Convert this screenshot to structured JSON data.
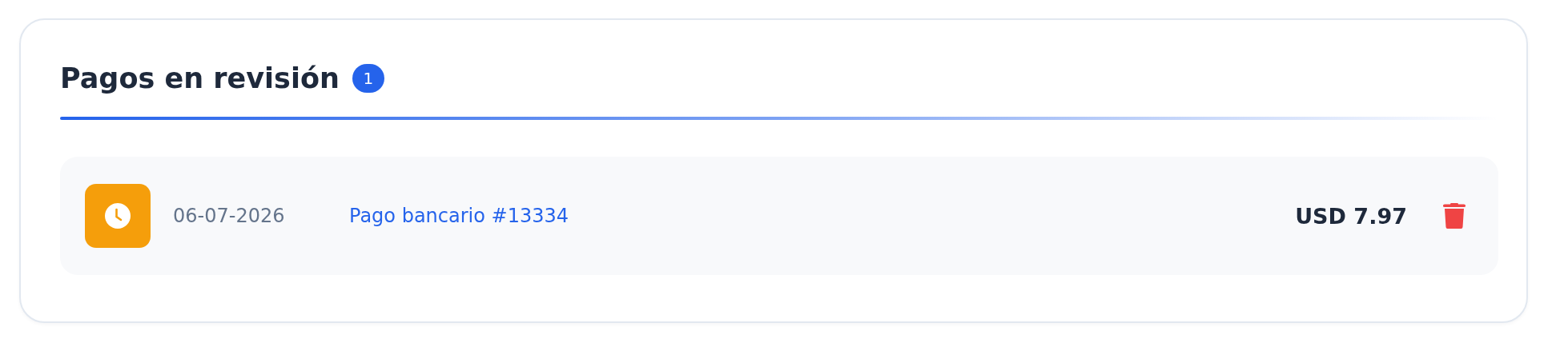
{
  "section": {
    "title": "Pagos en revisión",
    "count": "1"
  },
  "payments": [
    {
      "kind": "pending",
      "date": "06-07-2026",
      "reference": "Pago bancario #13334",
      "amount": "USD 7.97"
    }
  ]
}
